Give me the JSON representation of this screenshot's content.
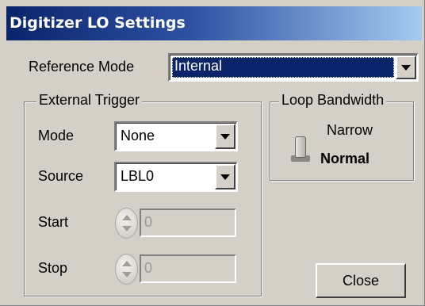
{
  "window": {
    "title": "Digitizer LO Settings"
  },
  "reference_mode": {
    "label": "Reference Mode",
    "value": "Internal"
  },
  "external_trigger": {
    "legend": "External Trigger",
    "mode_label": "Mode",
    "mode_value": "None",
    "source_label": "Source",
    "source_value": "LBL0",
    "start_label": "Start",
    "start_value": "0",
    "stop_label": "Stop",
    "stop_value": "0"
  },
  "loop_bandwidth": {
    "legend": "Loop Bandwidth",
    "option_narrow": "Narrow",
    "option_normal": "Normal",
    "selected": "Normal"
  },
  "buttons": {
    "close_label": "Close"
  }
}
